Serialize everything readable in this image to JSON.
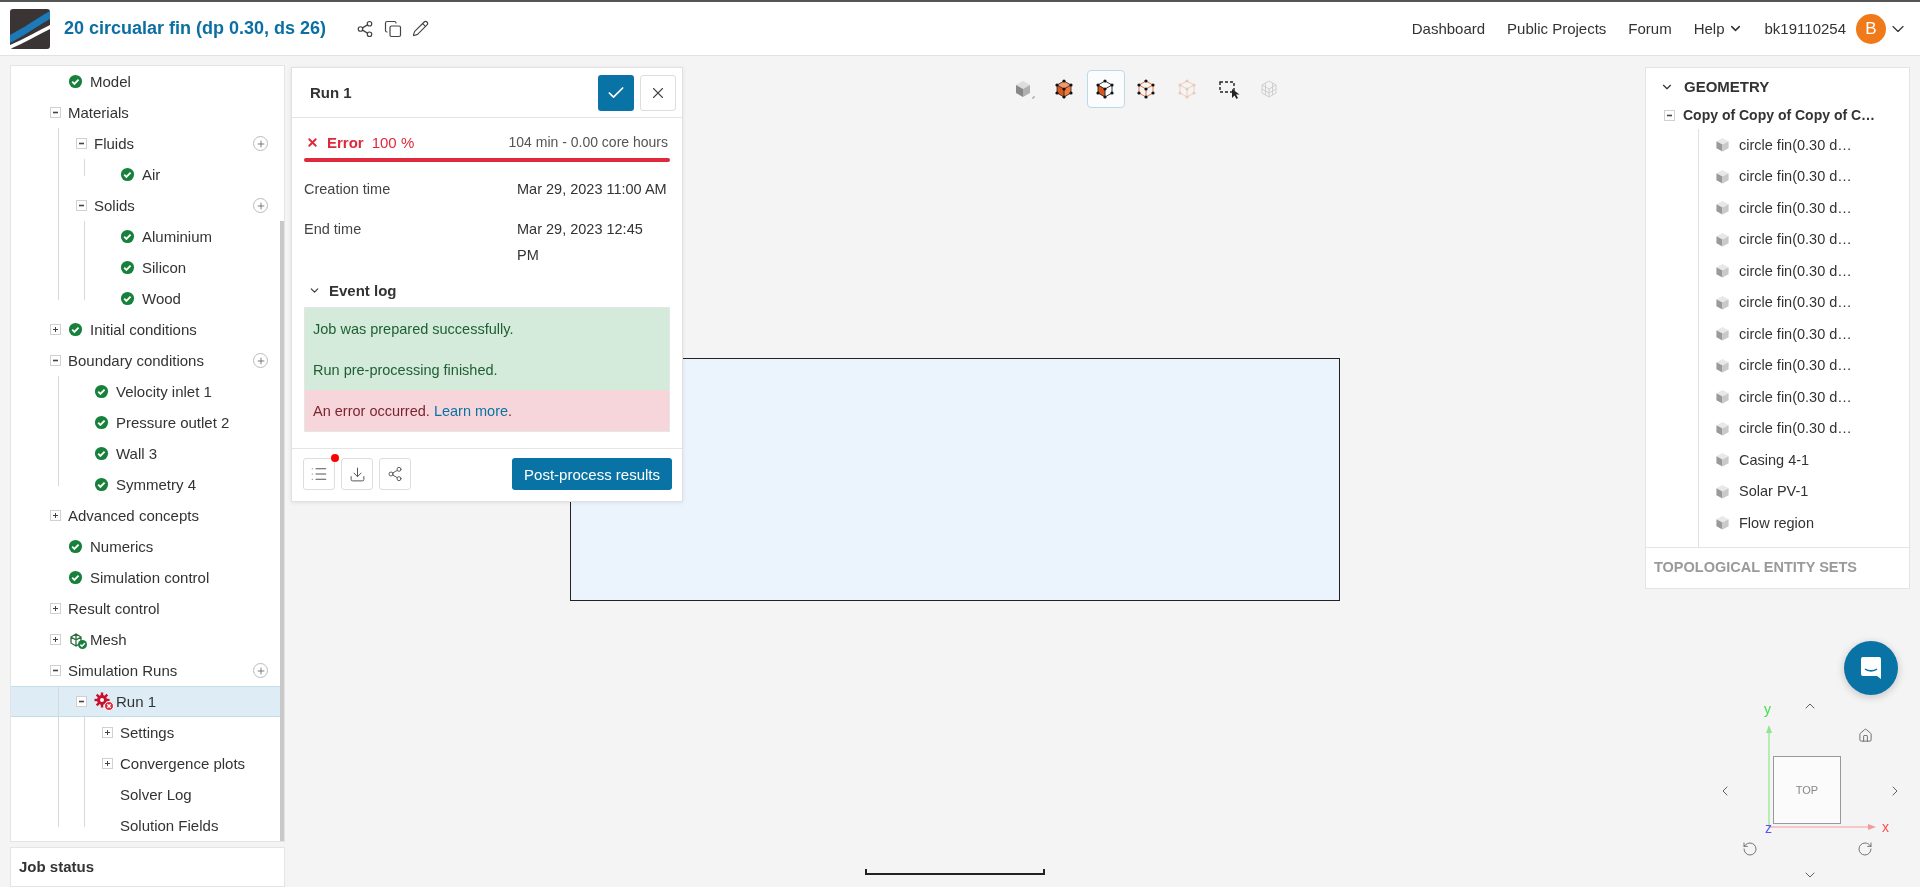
{
  "header": {
    "title": "20 circualar fin (dp 0.30, ds 26)",
    "nav": [
      "Dashboard",
      "Public Projects",
      "Forum"
    ],
    "help": "Help",
    "user": "bk19110254",
    "avatar": "B"
  },
  "tree": {
    "items": [
      {
        "label": "Model",
        "kind": "ok",
        "selected": false
      },
      {
        "label": "Materials",
        "expanded": true,
        "selected": false,
        "children": [
          {
            "label": "Fluids",
            "expanded": true,
            "addable": true,
            "selected": false,
            "children": [
              {
                "label": "Air",
                "kind": "ok",
                "selected": false
              }
            ]
          },
          {
            "label": "Solids",
            "expanded": true,
            "addable": true,
            "selected": false,
            "children": [
              {
                "label": "Aluminium",
                "kind": "ok",
                "selected": false
              },
              {
                "label": "Silicon",
                "kind": "ok",
                "selected": false
              },
              {
                "label": "Wood",
                "kind": "ok",
                "selected": false
              }
            ]
          }
        ]
      },
      {
        "label": "Initial conditions",
        "expanded": false,
        "kind": "ok",
        "selected": false
      },
      {
        "label": "Boundary conditions",
        "expanded": true,
        "addable": true,
        "selected": false,
        "children": [
          {
            "label": "Velocity inlet 1",
            "kind": "ok",
            "selected": false
          },
          {
            "label": "Pressure outlet 2",
            "kind": "ok",
            "selected": false
          },
          {
            "label": "Wall 3",
            "kind": "ok",
            "selected": false
          },
          {
            "label": "Symmetry 4",
            "kind": "ok",
            "selected": false
          }
        ]
      },
      {
        "label": "Advanced concepts",
        "expanded": false,
        "selected": false
      },
      {
        "label": "Numerics",
        "kind": "ok",
        "selected": false
      },
      {
        "label": "Simulation control",
        "kind": "ok",
        "selected": false
      },
      {
        "label": "Result control",
        "expanded": false,
        "selected": false
      },
      {
        "label": "Mesh",
        "expanded": false,
        "kind": "mesh-ok",
        "selected": false
      },
      {
        "label": "Simulation Runs",
        "expanded": true,
        "addable": true,
        "selected": false,
        "children": [
          {
            "label": "Run 1",
            "expanded": true,
            "kind": "error",
            "selected": true,
            "children": [
              {
                "label": "Settings",
                "expanded": false,
                "selected": false
              },
              {
                "label": "Convergence plots",
                "expanded": false,
                "selected": false
              },
              {
                "label": "Solver Log",
                "selected": false
              },
              {
                "label": "Solution Fields",
                "selected": false
              }
            ]
          }
        ]
      }
    ]
  },
  "job_status": {
    "title": "Job status"
  },
  "run_dialog": {
    "title": "Run 1",
    "status": "Error",
    "percent": "100 %",
    "duration": "104 min - 0.00 core hours",
    "level": 1,
    "fields": [
      {
        "label": "Creation time",
        "value": "Mar 29, 2023 11:00 AM"
      },
      {
        "label": "End time",
        "value": "Mar 29, 2023 12:45 PM"
      }
    ],
    "event_log": {
      "title": "Event log",
      "expanded": true,
      "entries": [
        {
          "kind": "success",
          "text": "Job was prepared successfully."
        },
        {
          "kind": "success",
          "text": "Run pre-processing finished."
        },
        {
          "kind": "error",
          "text": "An error occurred.",
          "link": "Learn more",
          "after": "."
        }
      ]
    },
    "has_notification": true,
    "primary_button": "Post-process results"
  },
  "toolbar": [
    {
      "kind": "shaded",
      "selected": false
    },
    {
      "kind": "solid",
      "selected": false
    },
    {
      "kind": "faces",
      "selected": true
    },
    {
      "kind": "wireframe",
      "selected": false
    },
    {
      "kind": "wireframe-faded",
      "selected": false
    },
    {
      "kind": "box-select",
      "selected": false
    },
    {
      "kind": "mesh-faded",
      "selected": false
    }
  ],
  "geometry": {
    "title": "GEOMETRY",
    "expanded": true,
    "root": {
      "label": "Copy of Copy of Copy of C…",
      "expanded": true,
      "children": [
        "circle fin(0.30 d…",
        "circle fin(0.30 d…",
        "circle fin(0.30 d…",
        "circle fin(0.30 d…",
        "circle fin(0.30 d…",
        "circle fin(0.30 d…",
        "circle fin(0.30 d…",
        "circle fin(0.30 d…",
        "circle fin(0.30 d…",
        "circle fin(0.30 d…",
        "Casing 4-1",
        "Solar PV-1",
        "Flow region"
      ]
    },
    "footer": "TOPOLOGICAL ENTITY SETS"
  },
  "view_cube": {
    "face": "TOP",
    "x_label": "x",
    "y_label": "y",
    "z_label": "z"
  }
}
